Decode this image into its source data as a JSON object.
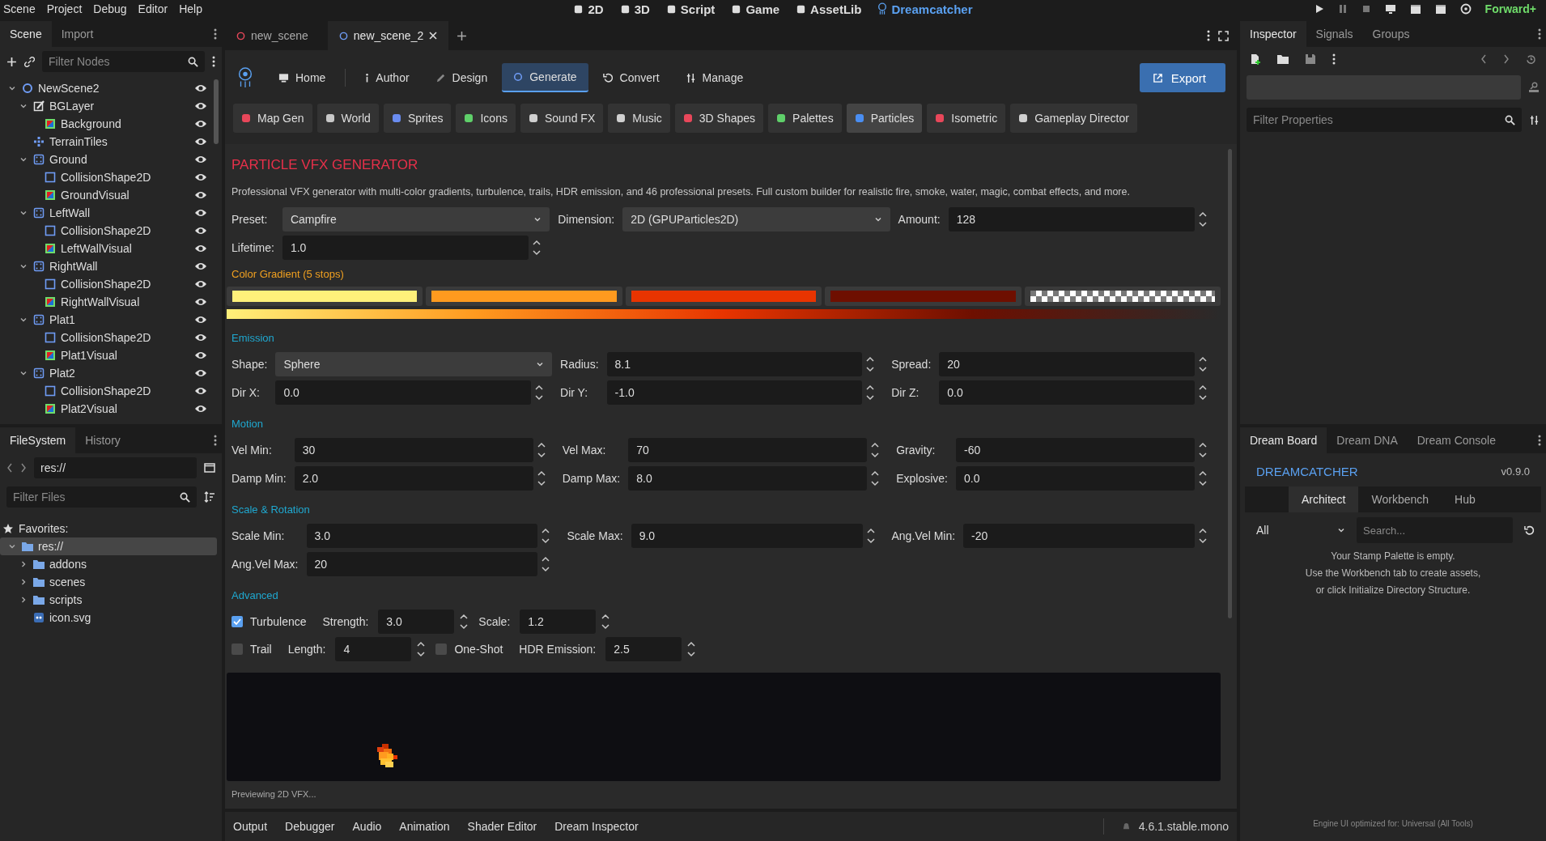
{
  "menu": [
    "Scene",
    "Project",
    "Debug",
    "Editor",
    "Help"
  ],
  "workspaces": [
    {
      "label": "2D",
      "kind": "planar",
      "selected": false
    },
    {
      "label": "3D",
      "kind": "spatial",
      "selected": false
    },
    {
      "label": "Script",
      "kind": "script",
      "selected": false
    },
    {
      "label": "Game",
      "kind": "game",
      "selected": false
    },
    {
      "label": "AssetLib",
      "kind": "assetlib",
      "selected": false
    },
    {
      "label": "Dreamcatcher",
      "kind": "dreamcatcher",
      "selected": true
    }
  ],
  "renderer": "Forward+",
  "scene_dock": {
    "tabs": [
      {
        "label": "Scene",
        "selected": true
      },
      {
        "label": "Import",
        "selected": false
      }
    ],
    "filter_placeholder": "Filter Nodes",
    "tree": [
      {
        "name": "NewScene2",
        "kind": "node2d",
        "visible": true,
        "expanded": true,
        "children": [
          {
            "name": "BGLayer",
            "kind": "canvaslayer",
            "visible": true,
            "expanded": true,
            "children": [
              {
                "name": "Background",
                "kind": "colorrect",
                "visible": true
              }
            ]
          },
          {
            "name": "TerrainTiles",
            "kind": "tilemap",
            "visible": true
          },
          {
            "name": "Ground",
            "kind": "body",
            "visible": true,
            "expanded": true,
            "children": [
              {
                "name": "CollisionShape2D",
                "kind": "collision",
                "visible": true
              },
              {
                "name": "GroundVisual",
                "kind": "colorrect",
                "visible": true
              }
            ]
          },
          {
            "name": "LeftWall",
            "kind": "body",
            "visible": true,
            "expanded": true,
            "children": [
              {
                "name": "CollisionShape2D",
                "kind": "collision",
                "visible": true
              },
              {
                "name": "LeftWallVisual",
                "kind": "colorrect",
                "visible": true
              }
            ]
          },
          {
            "name": "RightWall",
            "kind": "body",
            "visible": true,
            "expanded": true,
            "children": [
              {
                "name": "CollisionShape2D",
                "kind": "collision",
                "visible": true
              },
              {
                "name": "RightWallVisual",
                "kind": "colorrect",
                "visible": true
              }
            ]
          },
          {
            "name": "Plat1",
            "kind": "body",
            "visible": true,
            "expanded": true,
            "children": [
              {
                "name": "CollisionShape2D",
                "kind": "collision",
                "visible": true
              },
              {
                "name": "Plat1Visual",
                "kind": "colorrect",
                "visible": true
              }
            ]
          },
          {
            "name": "Plat2",
            "kind": "body",
            "visible": true,
            "expanded": true,
            "children": [
              {
                "name": "CollisionShape2D",
                "kind": "collision",
                "visible": true
              },
              {
                "name": "Plat2Visual",
                "kind": "colorrect",
                "visible": true
              }
            ]
          }
        ]
      }
    ]
  },
  "filesystem": {
    "tabs": [
      {
        "label": "FileSystem",
        "selected": true
      },
      {
        "label": "History",
        "selected": false
      }
    ],
    "path": "res://",
    "filter_placeholder": "Filter Files",
    "favorites": "Favorites:",
    "tree": [
      {
        "name": "res://",
        "kind": "folder",
        "expanded": true,
        "selected": true,
        "children": [
          {
            "name": "addons",
            "kind": "folder",
            "expanded": false,
            "selected": false
          },
          {
            "name": "scenes",
            "kind": "folder",
            "expanded": false,
            "selected": false
          },
          {
            "name": "scripts",
            "kind": "folder",
            "expanded": false,
            "selected": false
          },
          {
            "name": "icon.svg",
            "kind": "image",
            "selected": false
          }
        ]
      }
    ]
  },
  "scene_tabs": [
    {
      "label": "new_scene",
      "selected": false
    },
    {
      "label": "new_scene_2",
      "selected": true
    }
  ],
  "plugin": {
    "nav": [
      {
        "label": "Home",
        "kind": "home",
        "selected": false
      },
      {
        "label": "Author",
        "kind": "author",
        "selected": false
      },
      {
        "label": "Design",
        "kind": "design",
        "selected": false
      },
      {
        "label": "Generate",
        "kind": "generate",
        "selected": true
      },
      {
        "label": "Convert",
        "kind": "convert",
        "selected": false
      },
      {
        "label": "Manage",
        "kind": "manage",
        "selected": false
      }
    ],
    "export": "Export",
    "generators": [
      {
        "label": "Map Gen",
        "color": "#e8475a",
        "selected": false
      },
      {
        "label": "World",
        "color": "#c8c8c8",
        "selected": false
      },
      {
        "label": "Sprites",
        "color": "#6a8cf0",
        "selected": false
      },
      {
        "label": "Icons",
        "color": "#5fd06a",
        "selected": false
      },
      {
        "label": "Sound FX",
        "color": "#d0d0d0",
        "selected": false
      },
      {
        "label": "Music",
        "color": "#d0d0d0",
        "selected": false
      },
      {
        "label": "3D Shapes",
        "color": "#e8475a",
        "selected": false
      },
      {
        "label": "Palettes",
        "color": "#5fd06a",
        "selected": false
      },
      {
        "label": "Particles",
        "color": "#4a8ef2",
        "selected": true
      },
      {
        "label": "Isometric",
        "color": "#e8475a",
        "selected": false
      },
      {
        "label": "Gameplay Director",
        "color": "#d0d0d0",
        "selected": false
      }
    ],
    "title": "PARTICLE VFX GENERATOR",
    "description": "Professional VFX generator with multi-color gradients, turbulence, trails, HDR emission, and 46 professional presets. Full custom builder for realistic fire, smoke, water, magic, combat effects, and more.",
    "general": [
      [
        {
          "label": "Preset:",
          "kind": "select",
          "value": "Campfire"
        },
        {
          "label": "Dimension:",
          "kind": "select",
          "value": "2D (GPUParticles2D)"
        },
        {
          "label": "Amount:",
          "kind": "spin",
          "value": "128"
        }
      ],
      [
        {
          "label": "Lifetime:",
          "kind": "spin",
          "value": "1.0"
        }
      ]
    ],
    "gradient": {
      "label": "Color Gradient (5 stops)",
      "stops": [
        {
          "kind": "solid",
          "color": "#fff07a"
        },
        {
          "kind": "solid",
          "color": "#ff9a1f"
        },
        {
          "kind": "solid",
          "color": "#e83400"
        },
        {
          "kind": "solid",
          "color": "#6e0f00"
        },
        {
          "kind": "transparent"
        }
      ]
    },
    "sections": [
      {
        "heading": "Emission",
        "rows": [
          [
            {
              "label": "Shape:",
              "kind": "select",
              "value": "Sphere"
            },
            {
              "label": "Radius:",
              "kind": "spin",
              "value": "8.1"
            },
            {
              "label": "Spread:",
              "kind": "spin",
              "value": "20"
            }
          ],
          [
            {
              "label": "Dir X:",
              "kind": "spin",
              "value": "0.0"
            },
            {
              "label": "Dir Y:",
              "kind": "spin",
              "value": "-1.0"
            },
            {
              "label": "Dir Z:",
              "kind": "spin",
              "value": "0.0"
            }
          ]
        ]
      },
      {
        "heading": "Motion",
        "rows": [
          [
            {
              "label": "Vel Min:",
              "kind": "spin",
              "value": "30"
            },
            {
              "label": "Vel Max:",
              "kind": "spin",
              "value": "70"
            },
            {
              "label": "Gravity:",
              "kind": "spin",
              "value": "-60"
            }
          ],
          [
            {
              "label": "Damp Min:",
              "kind": "spin",
              "value": "2.0"
            },
            {
              "label": "Damp Max:",
              "kind": "spin",
              "value": "8.0"
            },
            {
              "label": "Explosive:",
              "kind": "spin",
              "value": "0.0"
            }
          ]
        ]
      },
      {
        "heading": "Scale & Rotation",
        "rows": [
          [
            {
              "label": "Scale Min:",
              "kind": "spin",
              "value": "3.0"
            },
            {
              "label": "Scale Max:",
              "kind": "spin",
              "value": "9.0"
            },
            {
              "label": "Ang.Vel Min:",
              "kind": "spin",
              "value": "-20"
            }
          ],
          [
            {
              "label": "Ang.Vel Max:",
              "kind": "spin",
              "value": "20"
            }
          ]
        ]
      }
    ],
    "advanced": {
      "heading": "Advanced",
      "rows": [
        [
          {
            "kind": "check",
            "label": "Turbulence",
            "checked": true
          },
          {
            "kind": "spin",
            "label": "Strength:",
            "value": "3.0"
          },
          {
            "kind": "spin",
            "label": "Scale:",
            "value": "1.2"
          }
        ],
        [
          {
            "kind": "check",
            "label": "Trail",
            "checked": false
          },
          {
            "kind": "spin",
            "label": "Length:",
            "value": "4"
          },
          {
            "kind": "check",
            "label": "One-Shot",
            "checked": false
          },
          {
            "kind": "spin",
            "label": "HDR Emission:",
            "value": "2.5"
          }
        ]
      ]
    },
    "status": "Previewing 2D VFX..."
  },
  "bottom_tabs": [
    "Output",
    "Debugger",
    "Audio",
    "Animation",
    "Shader Editor",
    "Dream Inspector"
  ],
  "version": "4.6.1.stable.mono",
  "inspector": {
    "tabs": [
      {
        "label": "Inspector",
        "selected": true
      },
      {
        "label": "Signals",
        "selected": false
      },
      {
        "label": "Groups",
        "selected": false
      }
    ],
    "filter_placeholder": "Filter Properties"
  },
  "dream": {
    "tabs": [
      {
        "label": "Dream Board",
        "selected": true
      },
      {
        "label": "Dream DNA",
        "selected": false
      },
      {
        "label": "Dream Console",
        "selected": false
      }
    ],
    "title": "DREAMCATCHER",
    "version": "v0.9.0",
    "subtabs": [
      {
        "label": "Architect",
        "selected": true
      },
      {
        "label": "Workbench",
        "selected": false
      },
      {
        "label": "Hub",
        "selected": false
      }
    ],
    "filter": "All",
    "search_placeholder": "Search...",
    "empty_message": [
      "Your Stamp Palette is empty.",
      "Use the Workbench tab to create assets,",
      "or click Initialize Directory Structure."
    ],
    "footer": "Engine UI optimized for: Universal (All Tools)"
  }
}
